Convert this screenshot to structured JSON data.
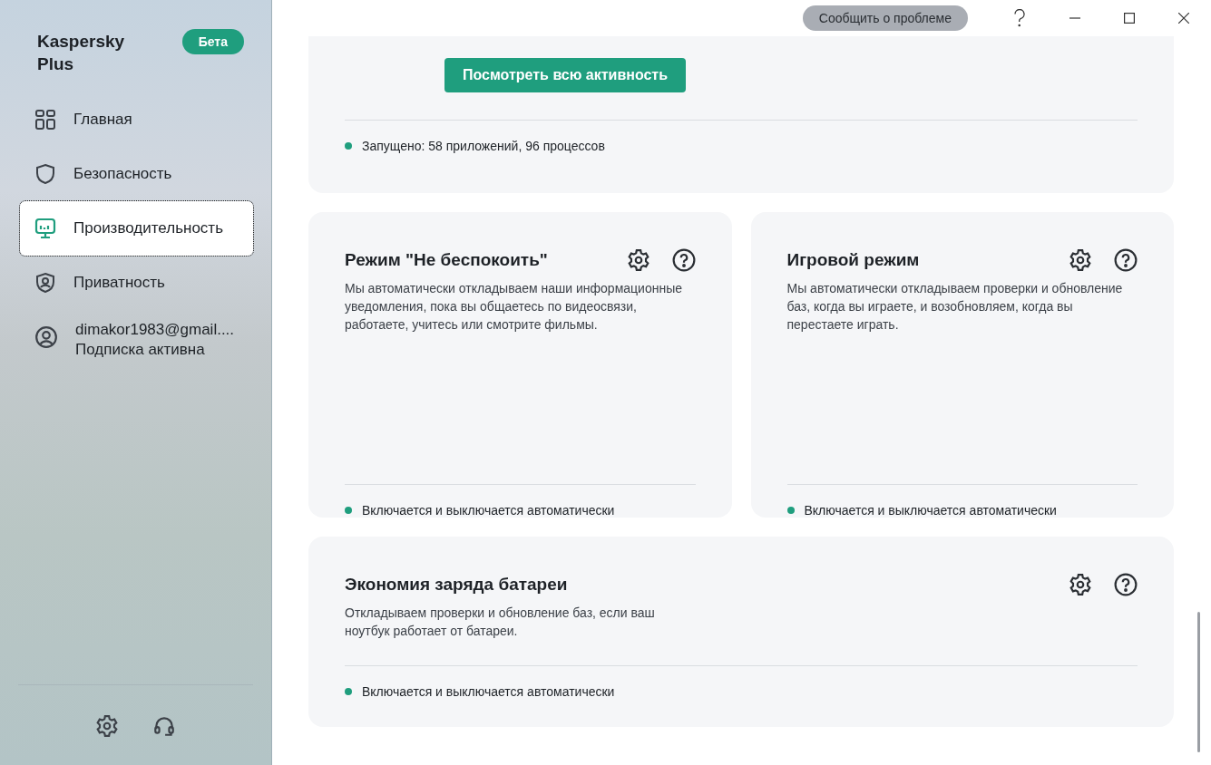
{
  "sidebar": {
    "brand": "Kaspersky\nPlus",
    "badge": "Бета",
    "items": [
      {
        "kind": "home",
        "label": "Главная",
        "selected": false
      },
      {
        "kind": "shield",
        "label": "Безопасность",
        "selected": false
      },
      {
        "kind": "monitor",
        "label": "Производительность",
        "selected": true
      },
      {
        "kind": "privacy",
        "label": "Приватность",
        "selected": false
      },
      {
        "kind": "account",
        "label": "dimakor1983@gmail....",
        "sublabel": "Подписка активна",
        "selected": false
      }
    ]
  },
  "title_bar": {
    "report_button": "Сообщить о проблеме"
  },
  "activity_card": {
    "button": "Посмотреть всю активность",
    "status": "Запущено: 58 приложений, 96 процессов"
  },
  "feature_cards": [
    {
      "title": "Режим \"Не беспокоить\"",
      "description": "Мы автоматически откладываем наши информационные уведомления, пока вы общаетесь по видеосвязи, работаете, учитесь или смотрите фильмы.",
      "status": "Включается и выключается автоматически"
    },
    {
      "title": "Игровой режим",
      "description": "Мы автоматически откладываем проверки и обновление баз, когда вы играете, и возобновляем, когда вы перестаете играть.",
      "status": "Включается и выключается автоматически"
    },
    {
      "title": "Экономия заряда батареи",
      "description": "Откладываем проверки и обновление баз, если ваш ноутбук работает от батареи.",
      "status": "Включается и выключается автоматически"
    }
  ]
}
